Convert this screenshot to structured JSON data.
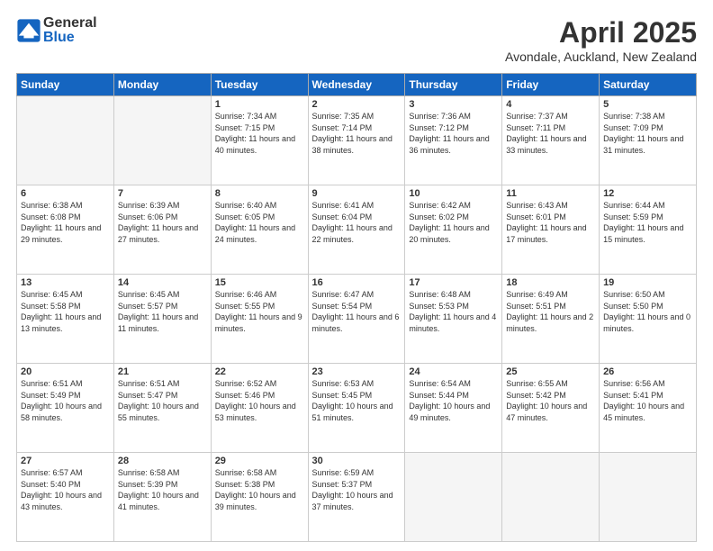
{
  "header": {
    "logo_general": "General",
    "logo_blue": "Blue",
    "title": "April 2025",
    "location": "Avondale, Auckland, New Zealand"
  },
  "columns": [
    "Sunday",
    "Monday",
    "Tuesday",
    "Wednesday",
    "Thursday",
    "Friday",
    "Saturday"
  ],
  "weeks": [
    [
      {
        "day": "",
        "info": ""
      },
      {
        "day": "",
        "info": ""
      },
      {
        "day": "1",
        "info": "Sunrise: 7:34 AM\nSunset: 7:15 PM\nDaylight: 11 hours\nand 40 minutes."
      },
      {
        "day": "2",
        "info": "Sunrise: 7:35 AM\nSunset: 7:14 PM\nDaylight: 11 hours\nand 38 minutes."
      },
      {
        "day": "3",
        "info": "Sunrise: 7:36 AM\nSunset: 7:12 PM\nDaylight: 11 hours\nand 36 minutes."
      },
      {
        "day": "4",
        "info": "Sunrise: 7:37 AM\nSunset: 7:11 PM\nDaylight: 11 hours\nand 33 minutes."
      },
      {
        "day": "5",
        "info": "Sunrise: 7:38 AM\nSunset: 7:09 PM\nDaylight: 11 hours\nand 31 minutes."
      }
    ],
    [
      {
        "day": "6",
        "info": "Sunrise: 6:38 AM\nSunset: 6:08 PM\nDaylight: 11 hours\nand 29 minutes."
      },
      {
        "day": "7",
        "info": "Sunrise: 6:39 AM\nSunset: 6:06 PM\nDaylight: 11 hours\nand 27 minutes."
      },
      {
        "day": "8",
        "info": "Sunrise: 6:40 AM\nSunset: 6:05 PM\nDaylight: 11 hours\nand 24 minutes."
      },
      {
        "day": "9",
        "info": "Sunrise: 6:41 AM\nSunset: 6:04 PM\nDaylight: 11 hours\nand 22 minutes."
      },
      {
        "day": "10",
        "info": "Sunrise: 6:42 AM\nSunset: 6:02 PM\nDaylight: 11 hours\nand 20 minutes."
      },
      {
        "day": "11",
        "info": "Sunrise: 6:43 AM\nSunset: 6:01 PM\nDaylight: 11 hours\nand 17 minutes."
      },
      {
        "day": "12",
        "info": "Sunrise: 6:44 AM\nSunset: 5:59 PM\nDaylight: 11 hours\nand 15 minutes."
      }
    ],
    [
      {
        "day": "13",
        "info": "Sunrise: 6:45 AM\nSunset: 5:58 PM\nDaylight: 11 hours\nand 13 minutes."
      },
      {
        "day": "14",
        "info": "Sunrise: 6:45 AM\nSunset: 5:57 PM\nDaylight: 11 hours\nand 11 minutes."
      },
      {
        "day": "15",
        "info": "Sunrise: 6:46 AM\nSunset: 5:55 PM\nDaylight: 11 hours\nand 9 minutes."
      },
      {
        "day": "16",
        "info": "Sunrise: 6:47 AM\nSunset: 5:54 PM\nDaylight: 11 hours\nand 6 minutes."
      },
      {
        "day": "17",
        "info": "Sunrise: 6:48 AM\nSunset: 5:53 PM\nDaylight: 11 hours\nand 4 minutes."
      },
      {
        "day": "18",
        "info": "Sunrise: 6:49 AM\nSunset: 5:51 PM\nDaylight: 11 hours\nand 2 minutes."
      },
      {
        "day": "19",
        "info": "Sunrise: 6:50 AM\nSunset: 5:50 PM\nDaylight: 11 hours\nand 0 minutes."
      }
    ],
    [
      {
        "day": "20",
        "info": "Sunrise: 6:51 AM\nSunset: 5:49 PM\nDaylight: 10 hours\nand 58 minutes."
      },
      {
        "day": "21",
        "info": "Sunrise: 6:51 AM\nSunset: 5:47 PM\nDaylight: 10 hours\nand 55 minutes."
      },
      {
        "day": "22",
        "info": "Sunrise: 6:52 AM\nSunset: 5:46 PM\nDaylight: 10 hours\nand 53 minutes."
      },
      {
        "day": "23",
        "info": "Sunrise: 6:53 AM\nSunset: 5:45 PM\nDaylight: 10 hours\nand 51 minutes."
      },
      {
        "day": "24",
        "info": "Sunrise: 6:54 AM\nSunset: 5:44 PM\nDaylight: 10 hours\nand 49 minutes."
      },
      {
        "day": "25",
        "info": "Sunrise: 6:55 AM\nSunset: 5:42 PM\nDaylight: 10 hours\nand 47 minutes."
      },
      {
        "day": "26",
        "info": "Sunrise: 6:56 AM\nSunset: 5:41 PM\nDaylight: 10 hours\nand 45 minutes."
      }
    ],
    [
      {
        "day": "27",
        "info": "Sunrise: 6:57 AM\nSunset: 5:40 PM\nDaylight: 10 hours\nand 43 minutes."
      },
      {
        "day": "28",
        "info": "Sunrise: 6:58 AM\nSunset: 5:39 PM\nDaylight: 10 hours\nand 41 minutes."
      },
      {
        "day": "29",
        "info": "Sunrise: 6:58 AM\nSunset: 5:38 PM\nDaylight: 10 hours\nand 39 minutes."
      },
      {
        "day": "30",
        "info": "Sunrise: 6:59 AM\nSunset: 5:37 PM\nDaylight: 10 hours\nand 37 minutes."
      },
      {
        "day": "",
        "info": ""
      },
      {
        "day": "",
        "info": ""
      },
      {
        "day": "",
        "info": ""
      }
    ]
  ]
}
